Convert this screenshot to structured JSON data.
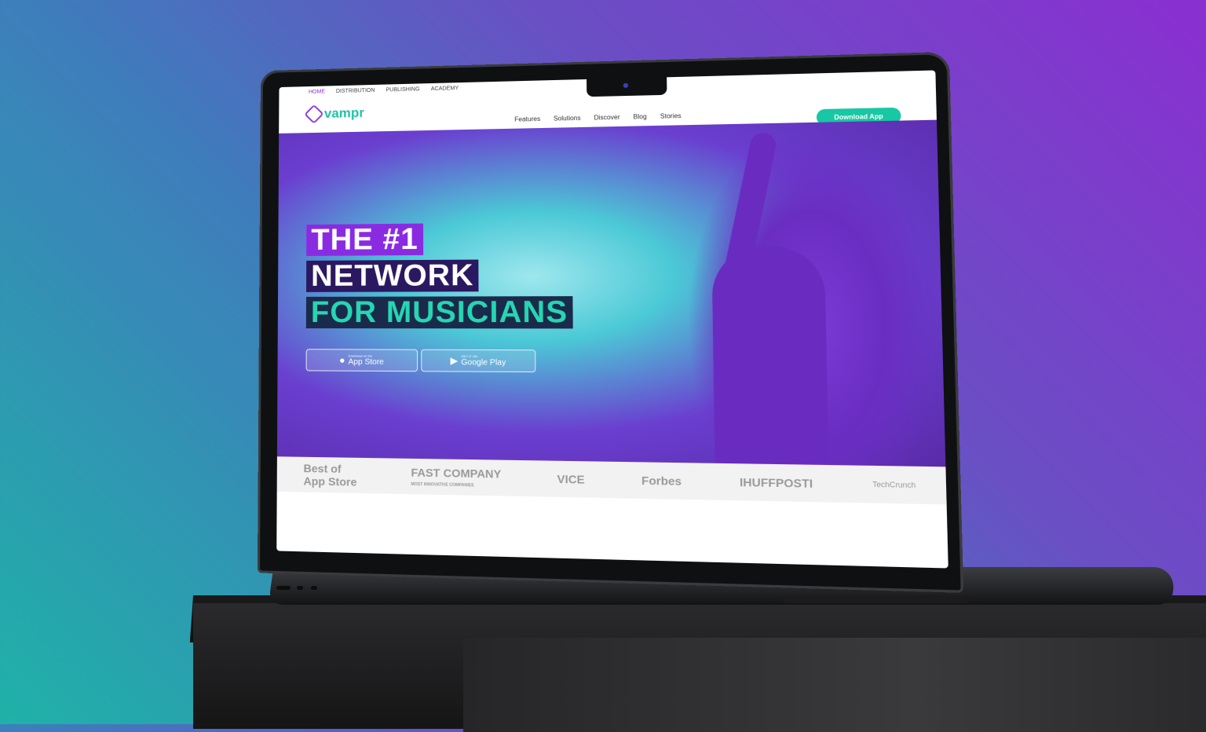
{
  "site": {
    "top_nav": [
      "HOME",
      "DISTRIBUTION",
      "PUBLISHING",
      "ACADEMY"
    ],
    "logo_text": "vampr",
    "main_nav": [
      "Features",
      "Solutions",
      "Discover",
      "Blog",
      "Stories"
    ],
    "download_button": "Download App"
  },
  "hero": {
    "line1": "THE #1",
    "line2": "NETWORK",
    "line3": "FOR MUSICIANS",
    "app_store": {
      "small": "Download on the",
      "big": "App Store",
      "icon": "apple-icon"
    },
    "google_play": {
      "small": "GET IT ON",
      "big": "Google Play",
      "icon": "play-icon"
    }
  },
  "press": {
    "best_of": "Best of",
    "app_store": "App Store",
    "fast_company": "FAST COMPANY",
    "fast_company_sub": "MOST INNOVATIVE COMPANIES",
    "vice": "VICE",
    "forbes": "Forbes",
    "huffpost": "IHUFFPOSTI",
    "techcrunch": "TechCrunch"
  },
  "colors": {
    "accent_green": "#18c7a3",
    "accent_purple": "#8a2be2"
  }
}
